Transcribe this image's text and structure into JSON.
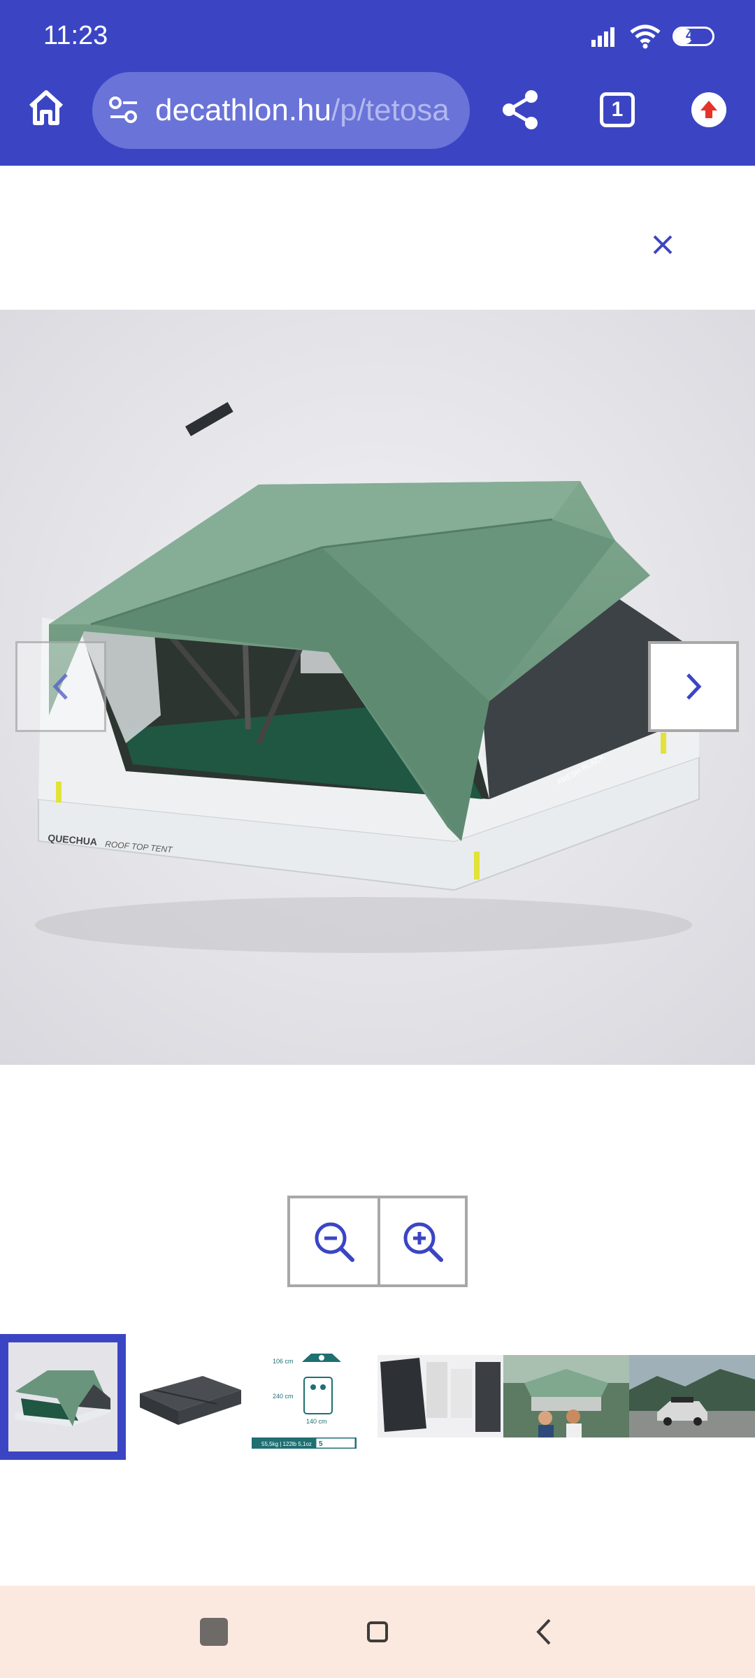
{
  "status_bar": {
    "time": "11:23",
    "battery": "46",
    "battery_level": 0.46,
    "icons": [
      "signal-icon",
      "wifi-icon",
      "battery-icon"
    ]
  },
  "browser": {
    "url_domain": "decathlon.hu",
    "url_path": "/p/tetosa",
    "tab_count": "1",
    "icons": [
      "home-icon",
      "site-settings-icon",
      "share-icon",
      "tabs-icon",
      "update-icon"
    ]
  },
  "viewer": {
    "close_icon": "close-icon",
    "main_image_alt": "tent-image",
    "prev_icon": "chevron-left-icon",
    "next_icon": "chevron-right-icon",
    "zoom_out_icon": "zoom-out-icon",
    "zoom_in_icon": "zoom-in-icon",
    "selected_thumbnail": 1,
    "thumbnails": [
      {
        "name": "thumbnail-tent-open"
      },
      {
        "name": "thumbnail-tent-closed"
      },
      {
        "name": "thumbnail-dimensions",
        "labels": [
          "106 cm",
          "240 cm",
          "140 cm",
          "55,5kg | 122lb 5,1oz",
          "5"
        ]
      },
      {
        "name": "thumbnail-components"
      },
      {
        "name": "thumbnail-lifestyle"
      },
      {
        "name": "thumbnail-car-landscape"
      }
    ]
  },
  "tent_labels": {
    "brand": "QUECHUA",
    "model": "ROOF TOP TENT",
    "tag": "FRESH BLACK"
  },
  "colors": {
    "brand_blue": "#3b45c4",
    "tent_green": "#6f9a80",
    "navbar_bg": "#fbe9df"
  }
}
